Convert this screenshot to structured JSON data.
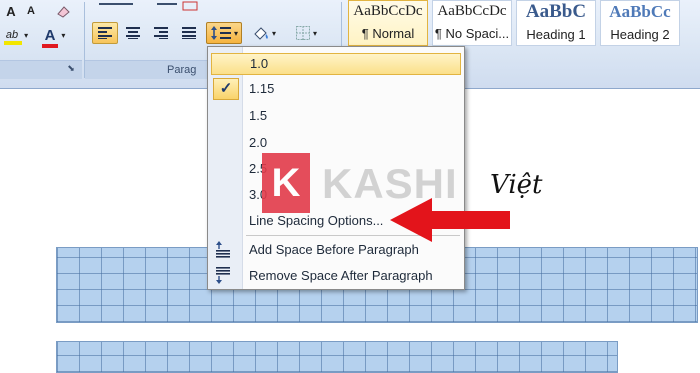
{
  "ribbon": {
    "font_group": {
      "aa_label": "A",
      "font_color_glyph": "A",
      "highlight_glyph": "ab"
    },
    "paragraph_group": {
      "footer_label": "Parag"
    },
    "styles": [
      {
        "sample": "AaBbCcDc",
        "name": "¶ Normal"
      },
      {
        "sample": "AaBbCcDc",
        "name": "¶ No Spaci..."
      },
      {
        "sample": "AaBbC",
        "name": "Heading 1"
      },
      {
        "sample": "AaBbCc",
        "name": "Heading 2"
      }
    ],
    "colors": {
      "font_color": "#e0191f",
      "highlight": "#f2e600",
      "heading_text": "#3a5a8c"
    }
  },
  "line_spacing_menu": {
    "items": [
      {
        "label": "1.0",
        "state": "hover"
      },
      {
        "label": "1.15",
        "state": "checked"
      },
      {
        "label": "1.5"
      },
      {
        "label": "2.0"
      },
      {
        "label": "2.5"
      },
      {
        "label": "3.0"
      }
    ],
    "options_label": "Line Spacing Options...",
    "add_space_label": "Add Space Before Paragraph",
    "remove_space_label": "Remove Space After Paragraph",
    "check_glyph": "✓"
  },
  "document": {
    "visible_text": "Việt"
  },
  "watermark": {
    "logo_letter": "K",
    "brand": "KASHI"
  },
  "annotation": {
    "arrow_color": "#e3141b"
  }
}
